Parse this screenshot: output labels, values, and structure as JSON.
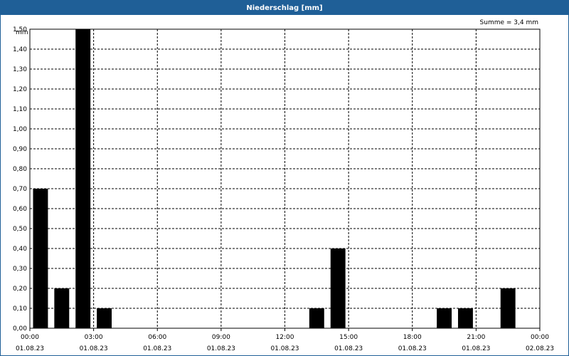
{
  "window": {
    "title": "Niederschlag [mm]"
  },
  "summary": "Summe = 3,4 mm",
  "chart_data": {
    "type": "bar",
    "title": "Niederschlag [mm]",
    "ylabel": "mm",
    "xlabel": "",
    "ylim": [
      0,
      1.5
    ],
    "yticks": [
      "0,00",
      "0,10",
      "0,20",
      "0,30",
      "0,40",
      "0,50",
      "0,60",
      "0,70",
      "0,80",
      "0,90",
      "1,00",
      "1,10",
      "1,20",
      "1,30",
      "1,40",
      "1,50"
    ],
    "xticks": [
      {
        "time": "00:00",
        "date": "01.08.23"
      },
      {
        "time": "03:00",
        "date": "01.08.23"
      },
      {
        "time": "06:00",
        "date": "01.08.23"
      },
      {
        "time": "09:00",
        "date": "01.08.23"
      },
      {
        "time": "12:00",
        "date": "01.08.23"
      },
      {
        "time": "15:00",
        "date": "01.08.23"
      },
      {
        "time": "18:00",
        "date": "01.08.23"
      },
      {
        "time": "21:00",
        "date": "01.08.23"
      },
      {
        "time": "00:00",
        "date": "02.08.23"
      }
    ],
    "x_range": [
      "01.08.23 00:00",
      "02.08.23 00:00"
    ],
    "categories": [
      "00:00",
      "01:00",
      "02:00",
      "03:00",
      "04:00",
      "05:00",
      "06:00",
      "07:00",
      "08:00",
      "09:00",
      "10:00",
      "11:00",
      "12:00",
      "13:00",
      "14:00",
      "15:00",
      "16:00",
      "17:00",
      "18:00",
      "19:00",
      "20:00",
      "21:00",
      "22:00",
      "23:00"
    ],
    "values": [
      0.7,
      0.2,
      1.5,
      0.1,
      0,
      0,
      0,
      0,
      0,
      0,
      0,
      0,
      0,
      0.1,
      0.4,
      0,
      0,
      0,
      0,
      0.1,
      0.1,
      0,
      0.2,
      0
    ],
    "grid": true,
    "bar_color": "#000000",
    "grid_color": "#000000"
  }
}
